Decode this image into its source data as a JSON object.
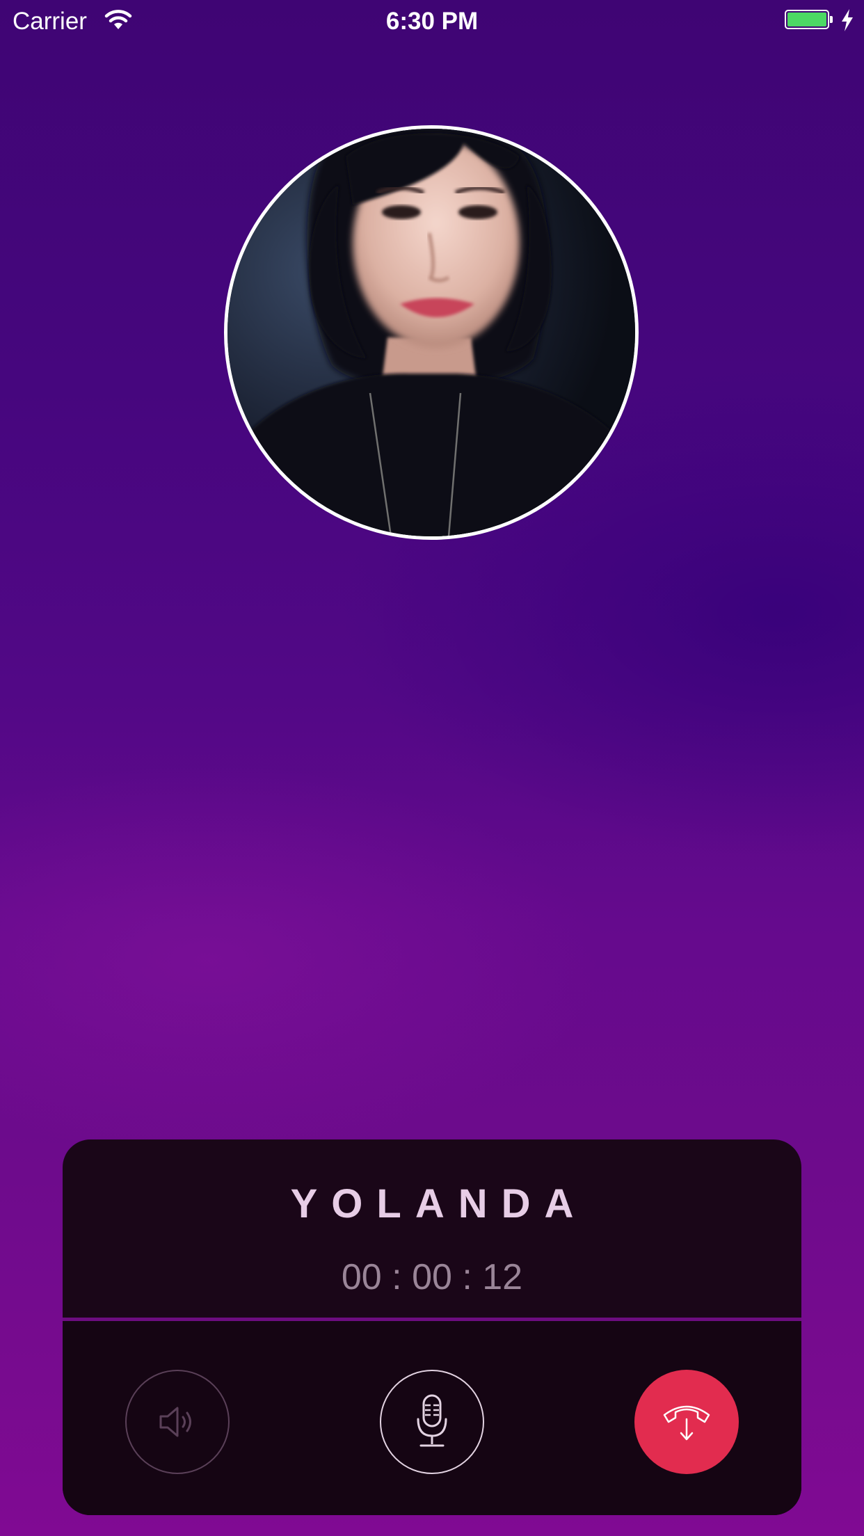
{
  "status_bar": {
    "carrier": "Carrier",
    "time": "6:30 PM",
    "wifi_icon": "wifi-icon",
    "battery_icon": "battery-icon",
    "battery_level_percent": 100,
    "battery_color": "#4cd964",
    "charging_icon": "charging-bolt-icon"
  },
  "call": {
    "caller_name": "YOLANDA",
    "duration": "00 : 00 : 12",
    "avatar": "caller-avatar-photo"
  },
  "controls": {
    "speaker_icon": "speaker-icon",
    "mic_icon": "microphone-icon",
    "end_call_icon": "end-call-icon",
    "end_call_color": "#e22c4f"
  }
}
